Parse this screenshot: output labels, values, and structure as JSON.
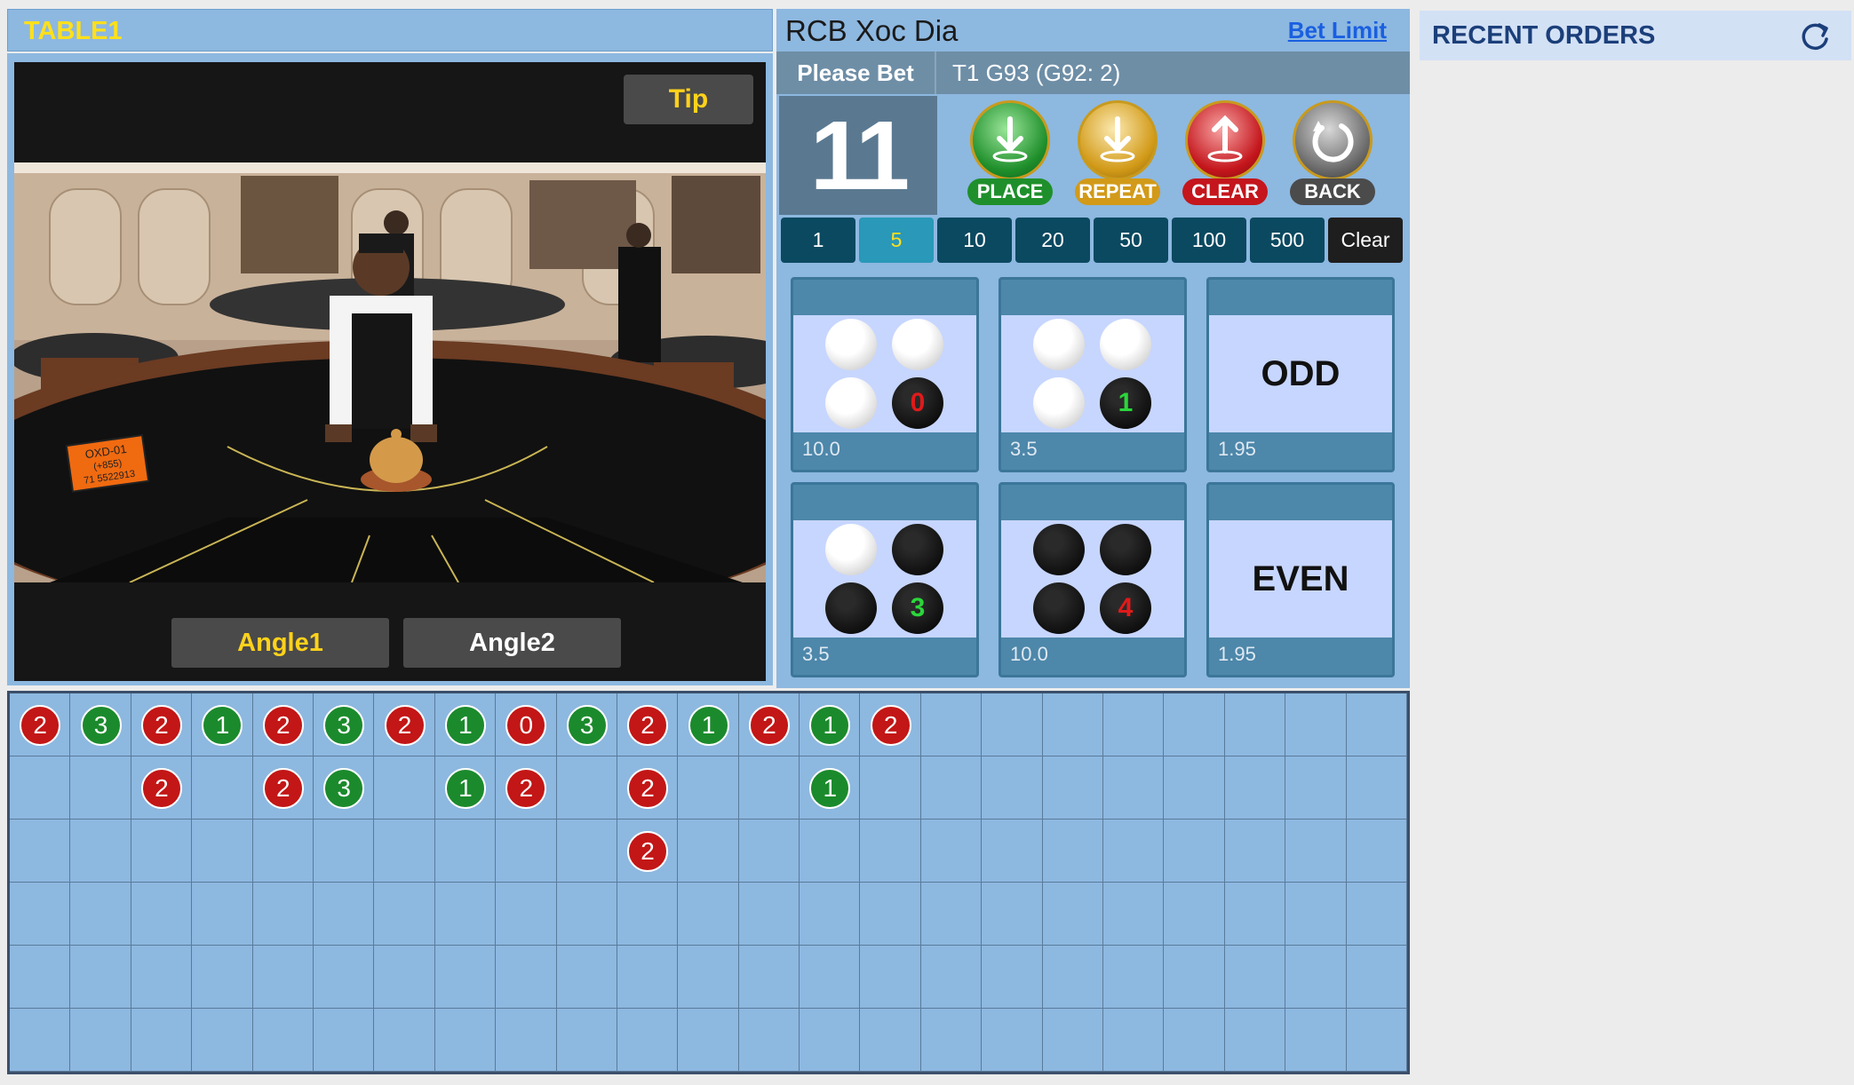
{
  "table": {
    "title": "TABLE1"
  },
  "video": {
    "tip_label": "Tip",
    "angle1_label": "Angle1",
    "angle2_label": "Angle2",
    "placard_line1": "OXD-01",
    "placard_line2": "(+855)",
    "placard_line3": "71 5522913"
  },
  "game": {
    "title": "RCB Xoc Dia",
    "bet_limit_label": "Bet Limit",
    "status": "Please Bet",
    "round_info": "T1 G93 (G92: 2)",
    "countdown": "11"
  },
  "actions": [
    {
      "label": "PLACE",
      "icon": "download-icon",
      "color": "#1f8f2b"
    },
    {
      "label": "REPEAT",
      "icon": "repeat-icon",
      "color": "#d29a18"
    },
    {
      "label": "CLEAR",
      "icon": "upload-icon",
      "color": "#c4161c"
    },
    {
      "label": "BACK",
      "icon": "undo-icon",
      "color": "#4b4b4b"
    }
  ],
  "chips": {
    "selected": "5",
    "values": [
      "1",
      "5",
      "10",
      "20",
      "50",
      "100",
      "500",
      "Clear"
    ]
  },
  "bets": [
    {
      "name": "bet-four-white",
      "odds": "10.0",
      "red_count": "0"
    },
    {
      "name": "bet-three-white",
      "odds": "3.5",
      "red_count": "1"
    },
    {
      "name": "bet-odd",
      "odds": "1.95",
      "label": "ODD"
    },
    {
      "name": "bet-three-red",
      "odds": "3.5",
      "red_count": "3"
    },
    {
      "name": "bet-four-red",
      "odds": "10.0",
      "red_count": "4"
    },
    {
      "name": "bet-even",
      "odds": "1.95",
      "label": "EVEN"
    }
  ],
  "recent_orders": {
    "title": "RECENT ORDERS"
  },
  "road": {
    "columns": [
      [
        "2"
      ],
      [
        "3"
      ],
      [
        "2",
        "2"
      ],
      [
        "1"
      ],
      [
        "2",
        "2"
      ],
      [
        "3",
        "3"
      ],
      [
        "2"
      ],
      [
        "1",
        "1"
      ],
      [
        "0",
        "2"
      ],
      [
        "3"
      ],
      [
        "2",
        "2",
        "2"
      ],
      [
        "1"
      ],
      [
        "2"
      ],
      [
        "1",
        "1"
      ],
      [
        "2"
      ]
    ],
    "colors": {
      "even": "#c31616",
      "odd": "#1b8a2c"
    }
  }
}
